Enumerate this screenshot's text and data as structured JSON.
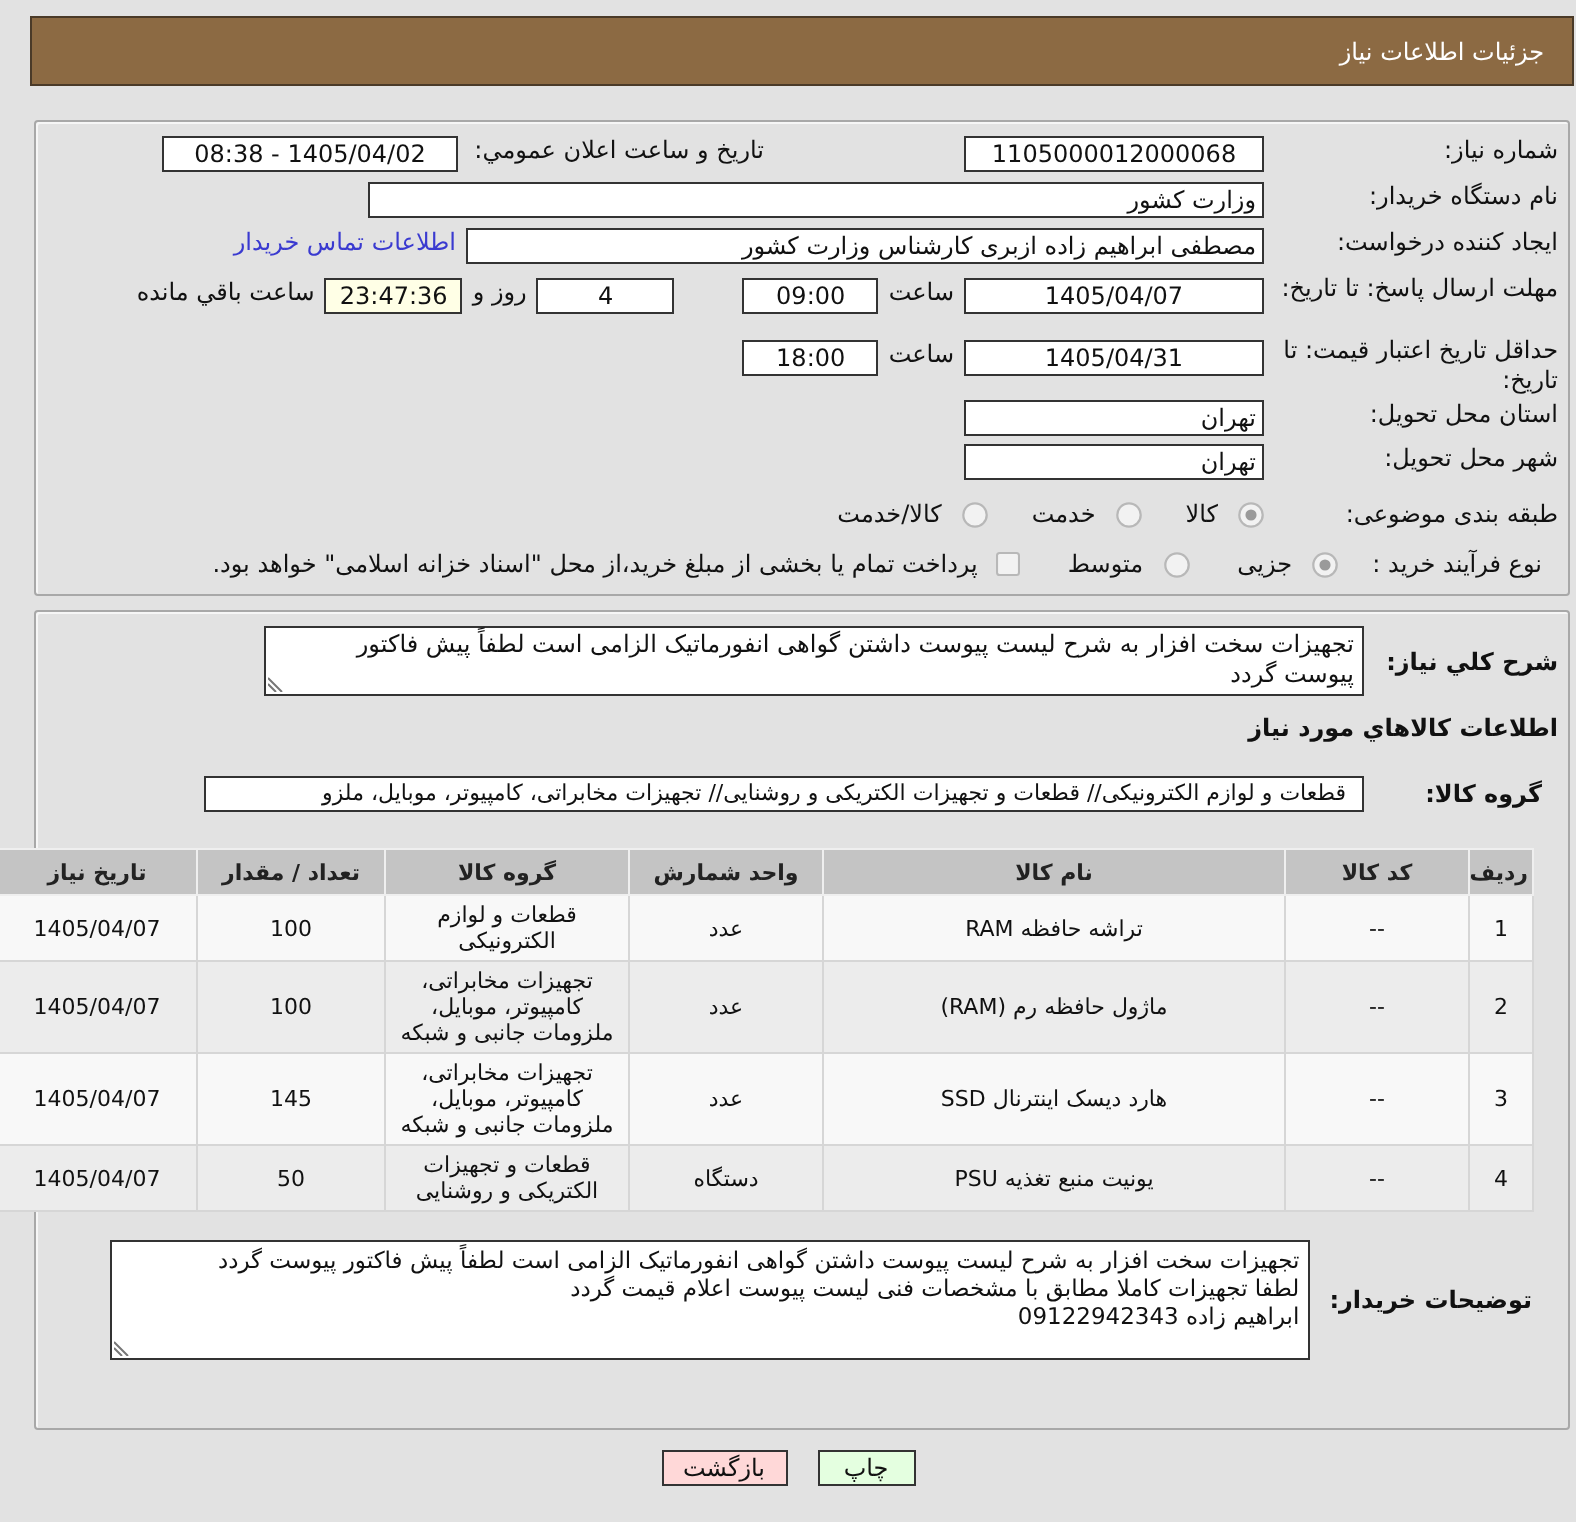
{
  "header": {
    "title": "جزئیات اطلاعات نیاز"
  },
  "details": {
    "need_number": {
      "label": "شماره نیاز:",
      "value": "1105000012000068"
    },
    "announcement": {
      "label": "تاریخ و ساعت اعلان عمومي:",
      "value": "1405/04/02 - 08:38"
    },
    "buyer_org": {
      "label": "نام دستگاه خریدار:",
      "value": "وزارت کشور"
    },
    "requester": {
      "label": "ایجاد کننده درخواست:",
      "value": "مصطفی ابراهیم زاده ازبری کارشناس وزارت کشور",
      "contact_link": "اطلاعات تماس خریدار"
    },
    "response_deadline": {
      "label": "مهلت ارسال پاسخ: تا تاریخ:",
      "date": "1405/04/07",
      "time_label": "ساعت",
      "time": "09:00",
      "days": "4",
      "days_label": "روز و",
      "remaining": "23:47:36",
      "remaining_label": "ساعت باقي مانده"
    },
    "price_validity": {
      "label": "حداقل تاریخ اعتبار قیمت: تا تاریخ:",
      "date": "1405/04/31",
      "time_label": "ساعت",
      "time": "18:00"
    },
    "province": {
      "label": "استان محل تحویل:",
      "value": "تهران"
    },
    "city": {
      "label": "شهر محل تحویل:",
      "value": "تهران"
    },
    "subject_category": {
      "label": "طبقه بندی موضوعی:",
      "disabled": true,
      "options": [
        {
          "label": "کالا",
          "selected": true
        },
        {
          "label": "خدمت",
          "selected": false
        },
        {
          "label": "کالا/خدمت",
          "selected": false
        }
      ]
    },
    "purchase_process": {
      "label": "نوع فرآیند خرید :",
      "disabled": true,
      "options": [
        {
          "label": "جزیی",
          "selected": true
        },
        {
          "label": "متوسط",
          "selected": false
        }
      ],
      "treasury_payment": {
        "label": "پرداخت تمام یا بخشی از مبلغ خرید،از محل \"اسناد خزانه اسلامی\" خواهد بود.",
        "checked": false
      }
    }
  },
  "description": {
    "label": "شرح کلي نیاز:",
    "value": "تجهیزات سخت افزار به شرح لیست پیوست داشتن گواهی انفورماتیک الزامی است لطفاً پیش فاکتور پیوست گردد"
  },
  "goods": {
    "title": "اطلاعات کالاهاي مورد نیاز",
    "group_label": "گروه کالا:",
    "group_value": "قطعات و لوازم الکترونیکی// قطعات و تجهیزات الکتریکی و روشنایی// تجهیزات مخابراتی، کامپیوتر، موبایل، ملزو"
  },
  "table": {
    "columns": [
      "ردیف",
      "کد کالا",
      "نام کالا",
      "واحد شمارش",
      "گروه کالا",
      "تعداد / مقدار",
      "تاریخ نیاز"
    ],
    "rows": [
      [
        "1",
        "--",
        "تراشه حافظه RAM",
        "عدد",
        "قطعات و لوازم الکترونیکی",
        "100",
        "1405/04/07"
      ],
      [
        "2",
        "--",
        "ماژول حافظه رم (RAM)",
        "عدد",
        "تجهیزات مخابراتی، کامپیوتر، موبایل، ملزومات جانبی و شبکه",
        "100",
        "1405/04/07"
      ],
      [
        "3",
        "--",
        "هارد دیسک اینترنال SSD",
        "عدد",
        "تجهیزات مخابراتی، کامپیوتر، موبایل، ملزومات جانبی و شبکه",
        "145",
        "1405/04/07"
      ],
      [
        "4",
        "--",
        "یونیت منبع تغذیه PSU",
        "دستگاه",
        "قطعات و تجهیزات الکتریکی و روشنایی",
        "50",
        "1405/04/07"
      ]
    ]
  },
  "buyer_notes": {
    "label": "توضیحات خریدار:",
    "lines": [
      "تجهیزات سخت افزار به شرح لیست پیوست داشتن گواهی انفورماتیک الزامی است لطفاً پیش فاکتور پیوست گردد",
      "لطفا تجهیزات کاملا مطابق با مشخصات فنی لیست پیوست اعلام قیمت گردد",
      "ابراهیم زاده 09122942343"
    ]
  },
  "buttons": [
    {
      "label": "چاپ",
      "kind": "print"
    },
    {
      "label": "بازگشت",
      "kind": "back"
    }
  ]
}
